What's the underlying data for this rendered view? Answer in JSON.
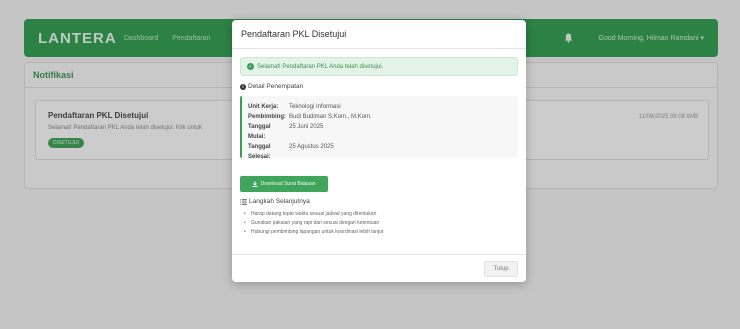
{
  "navbar": {
    "brand": "LANTERA",
    "links": [
      "Dashboard",
      "Pendaftaran"
    ],
    "user_greeting": "Good Morning, Hilman Ramdani",
    "accent_color": "#2e9c4e"
  },
  "notifications": {
    "title": "Notifikasi",
    "item": {
      "title": "Pendaftaran PKL Disetujui",
      "text": "Selamat! Pendaftaran PKL Anda telah disetujui. Klik untuk",
      "badge": "DISETUJUI",
      "time": "11/06/2025 09:08 WIB"
    }
  },
  "modal": {
    "title": "Pendaftaran PKL Disetujui",
    "success_message": "Selamat! Pendaftaran PKL Anda telah disetujui.",
    "detail_title": "Detail Penempatan",
    "details": [
      {
        "label": "Unit Kerja:",
        "value": "Teknologi Informasi"
      },
      {
        "label": "Pembimbing:",
        "value": "Budi Budiman S.Kom., M.Kom."
      },
      {
        "label": "Tanggal Mulai:",
        "value": "25 Juni 2025"
      },
      {
        "label": "Tanggal Selesai:",
        "value": "25 Agustus 2025"
      }
    ],
    "download_label": "Download Surat Balasan",
    "steps_title": "Langkah Selanjutnya",
    "steps": [
      "Harap datang tepat waktu sesuai jadwal yang ditentukan",
      "Gunakan pakaian yang rapi dan sesuai dengan ketentuan",
      "Hubungi pembimbing lapangan untuk koordinasi lebih lanjut"
    ],
    "close_label": "Tutup"
  }
}
